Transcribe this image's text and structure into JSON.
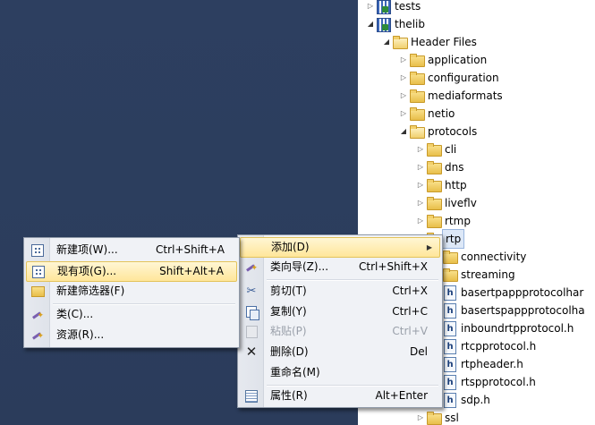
{
  "tree": {
    "items": [
      {
        "label": "tests",
        "type": "project",
        "level": 0,
        "expanded": false
      },
      {
        "label": "thelib",
        "type": "project",
        "level": 0,
        "expanded": true
      },
      {
        "label": "Header Files",
        "type": "folder-open",
        "level": 1,
        "expanded": true
      },
      {
        "label": "application",
        "type": "folder",
        "level": 2,
        "expanded": false
      },
      {
        "label": "configuration",
        "type": "folder",
        "level": 2,
        "expanded": false
      },
      {
        "label": "mediaformats",
        "type": "folder",
        "level": 2,
        "expanded": false
      },
      {
        "label": "netio",
        "type": "folder",
        "level": 2,
        "expanded": false
      },
      {
        "label": "protocols",
        "type": "folder-open",
        "level": 2,
        "expanded": true
      },
      {
        "label": "cli",
        "type": "folder",
        "level": 3,
        "expanded": false
      },
      {
        "label": "dns",
        "type": "folder",
        "level": 3,
        "expanded": false
      },
      {
        "label": "http",
        "type": "folder",
        "level": 3,
        "expanded": false
      },
      {
        "label": "liveflv",
        "type": "folder",
        "level": 3,
        "expanded": false
      },
      {
        "label": "rtmp",
        "type": "folder",
        "level": 3,
        "expanded": false
      },
      {
        "label": "rtp",
        "type": "folder-open",
        "level": 3,
        "expanded": true,
        "selected": true
      },
      {
        "label": "connectivity",
        "type": "folder",
        "level": 4
      },
      {
        "label": "streaming",
        "type": "folder",
        "level": 4
      },
      {
        "label": "basertpappprotocolhar",
        "type": "h",
        "level": 4
      },
      {
        "label": "basertspappprotocolha",
        "type": "h",
        "level": 4
      },
      {
        "label": "inboundrtpprotocol.h",
        "type": "h",
        "level": 4
      },
      {
        "label": "rtcpprotocol.h",
        "type": "h",
        "level": 4
      },
      {
        "label": "rtpheader.h",
        "type": "h",
        "level": 4
      },
      {
        "label": "rtspprotocol.h",
        "type": "h",
        "level": 4
      },
      {
        "label": "sdp.h",
        "type": "h",
        "level": 4
      },
      {
        "label": "ssl",
        "type": "folder",
        "level": 3,
        "expanded": false
      }
    ]
  },
  "context_menu": {
    "items": [
      {
        "label": "添加(D)",
        "shortcut": "",
        "icon": "none",
        "highlighted": true,
        "submenu": true
      },
      {
        "label": "类向导(Z)...",
        "shortcut": "Ctrl+Shift+X",
        "icon": "wizard-icon"
      },
      {
        "label": "剪切(T)",
        "shortcut": "Ctrl+X",
        "icon": "scissors-icon"
      },
      {
        "label": "复制(Y)",
        "shortcut": "Ctrl+C",
        "icon": "copy-icon"
      },
      {
        "label": "粘贴(P)",
        "shortcut": "Ctrl+V",
        "icon": "paste-icon",
        "disabled": true
      },
      {
        "label": "删除(D)",
        "shortcut": "Del",
        "icon": "delete-icon"
      },
      {
        "label": "重命名(M)",
        "shortcut": "",
        "icon": "none"
      },
      {
        "label": "属性(R)",
        "shortcut": "Alt+Enter",
        "icon": "properties-icon"
      }
    ]
  },
  "submenu": {
    "items": [
      {
        "label": "新建项(W)...",
        "shortcut": "Ctrl+Shift+A",
        "icon": "new-item-icon"
      },
      {
        "label": "现有项(G)...",
        "shortcut": "Shift+Alt+A",
        "icon": "existing-item-icon",
        "highlighted": true
      },
      {
        "label": "新建筛选器(F)",
        "shortcut": "",
        "icon": "filter-folder-icon"
      },
      {
        "label": "类(C)...",
        "shortcut": "",
        "icon": "class-wizard-icon"
      },
      {
        "label": "资源(R)...",
        "shortcut": "",
        "icon": "resource-wizard-icon"
      }
    ]
  }
}
